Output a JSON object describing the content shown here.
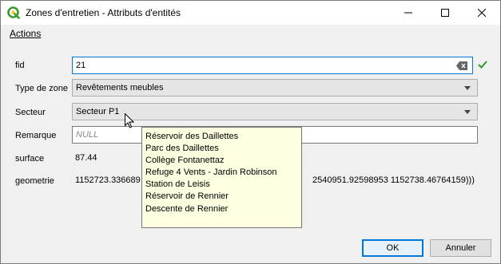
{
  "window": {
    "title": "Zones d'entretien - Attributs d'entités",
    "controls": {
      "minimize": "minimize-icon",
      "maximize": "maximize-icon",
      "close": "close-icon"
    }
  },
  "menu": {
    "actions_label": "Actions"
  },
  "form": {
    "fid": {
      "label": "fid",
      "value": "21"
    },
    "type_zone": {
      "label": "Type de zone",
      "value": "Revêtements meubles"
    },
    "secteur": {
      "label": "Secteur",
      "value": "Secteur P1"
    },
    "remarque": {
      "label": "Remarque",
      "placeholder": "NULL"
    },
    "surface": {
      "label": "surface",
      "value": "87.44"
    },
    "geometrie": {
      "label": "geometrie",
      "value_start": "1152723.336689",
      "value_end": "2540951.92598953 1152738.46764159)))"
    }
  },
  "tooltip": {
    "items": [
      "Réservoir des Daillettes",
      "Parc des Daillettes",
      "Collège Fontanettaz",
      "Refuge 4 Vents - Jardin Robinson",
      "Station de Leisis",
      "Réservoir de Rennier",
      "Descente de Rennier"
    ]
  },
  "buttons": {
    "ok": "OK",
    "cancel": "Annuler"
  },
  "colors": {
    "qgis_green": "#3a9a33",
    "check_green": "#2e9a2e",
    "accent": "#0078d7",
    "tooltip_bg": "#ffffe1"
  }
}
